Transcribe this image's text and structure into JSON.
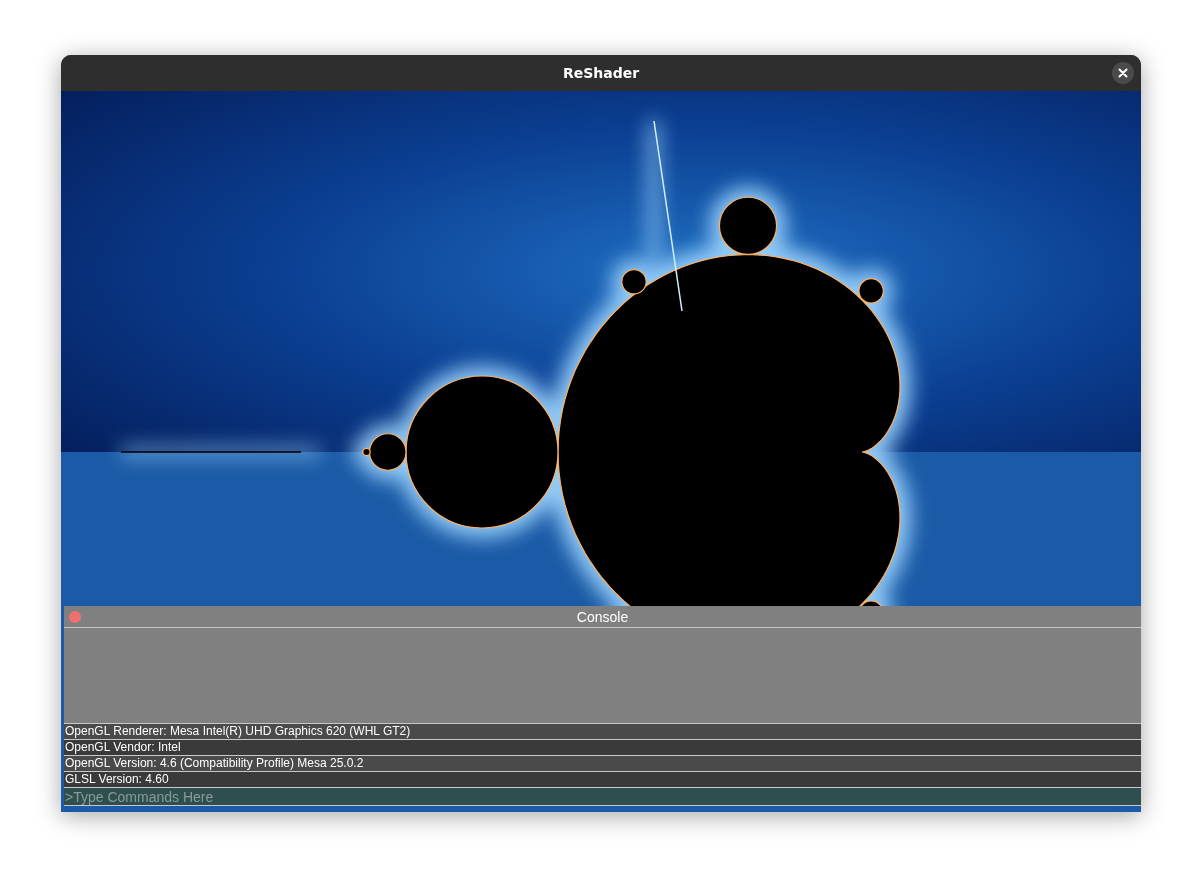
{
  "window": {
    "title": "ReShader"
  },
  "console": {
    "title": "Console",
    "log": [
      "OpenGL Renderer: Mesa Intel(R) UHD Graphics 620 (WHL GT2)",
      "OpenGL Vendor: Intel",
      "OpenGL Version: 4.6 (Compatibility Profile) Mesa 25.0.2",
      "GLSL Version: 4.60"
    ],
    "input": {
      "placeholder": ">Type Commands Here"
    }
  }
}
